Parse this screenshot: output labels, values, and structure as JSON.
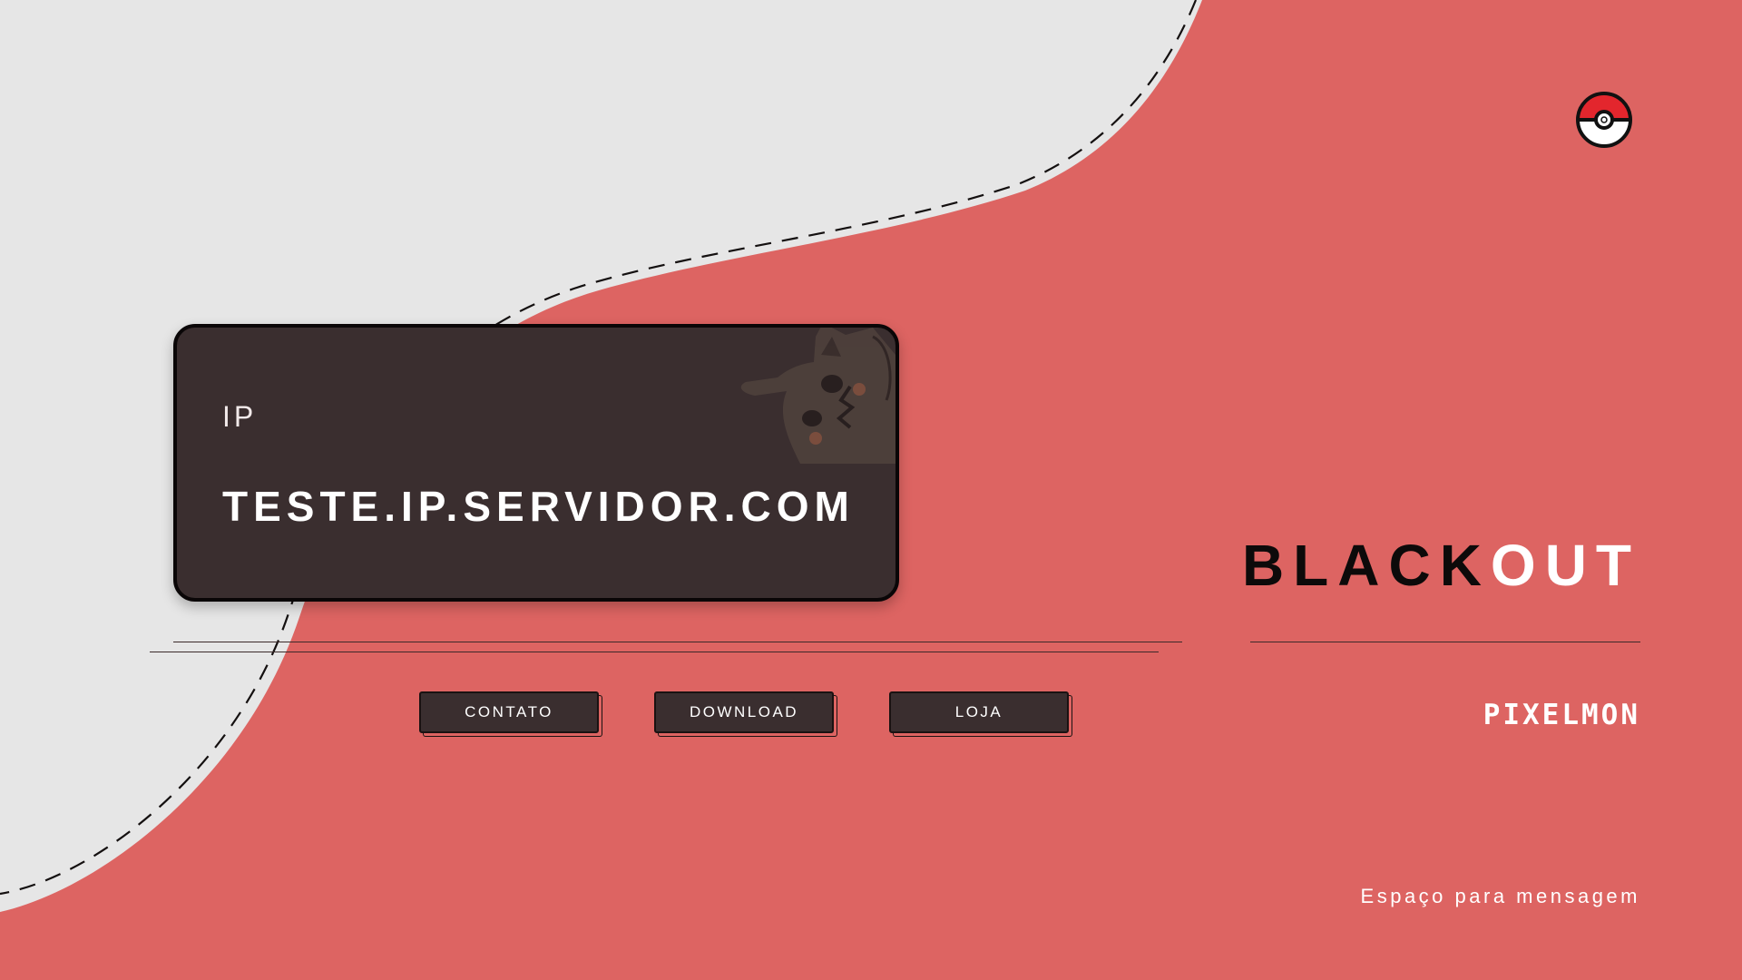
{
  "ip_card": {
    "label": "IP",
    "value": "TESTE.IP.SERVIDOR.COM"
  },
  "buttons": [
    {
      "label": "CONTATO"
    },
    {
      "label": "DOWNLOAD"
    },
    {
      "label": "LOJA"
    }
  ],
  "brand": {
    "part1": "BLACK",
    "part2": "OUT"
  },
  "subtitle": "PIXELMON",
  "message": "Espaço para mensagem",
  "colors": {
    "background": "#dd6462",
    "light_shape": "#e6e6e6",
    "card": "#3a2e2f",
    "text_dark": "#0d0a0a",
    "text_light": "#ffffff"
  },
  "icons": {
    "logo": "pokeball-icon",
    "card_art": "mimikyu-illustration"
  }
}
